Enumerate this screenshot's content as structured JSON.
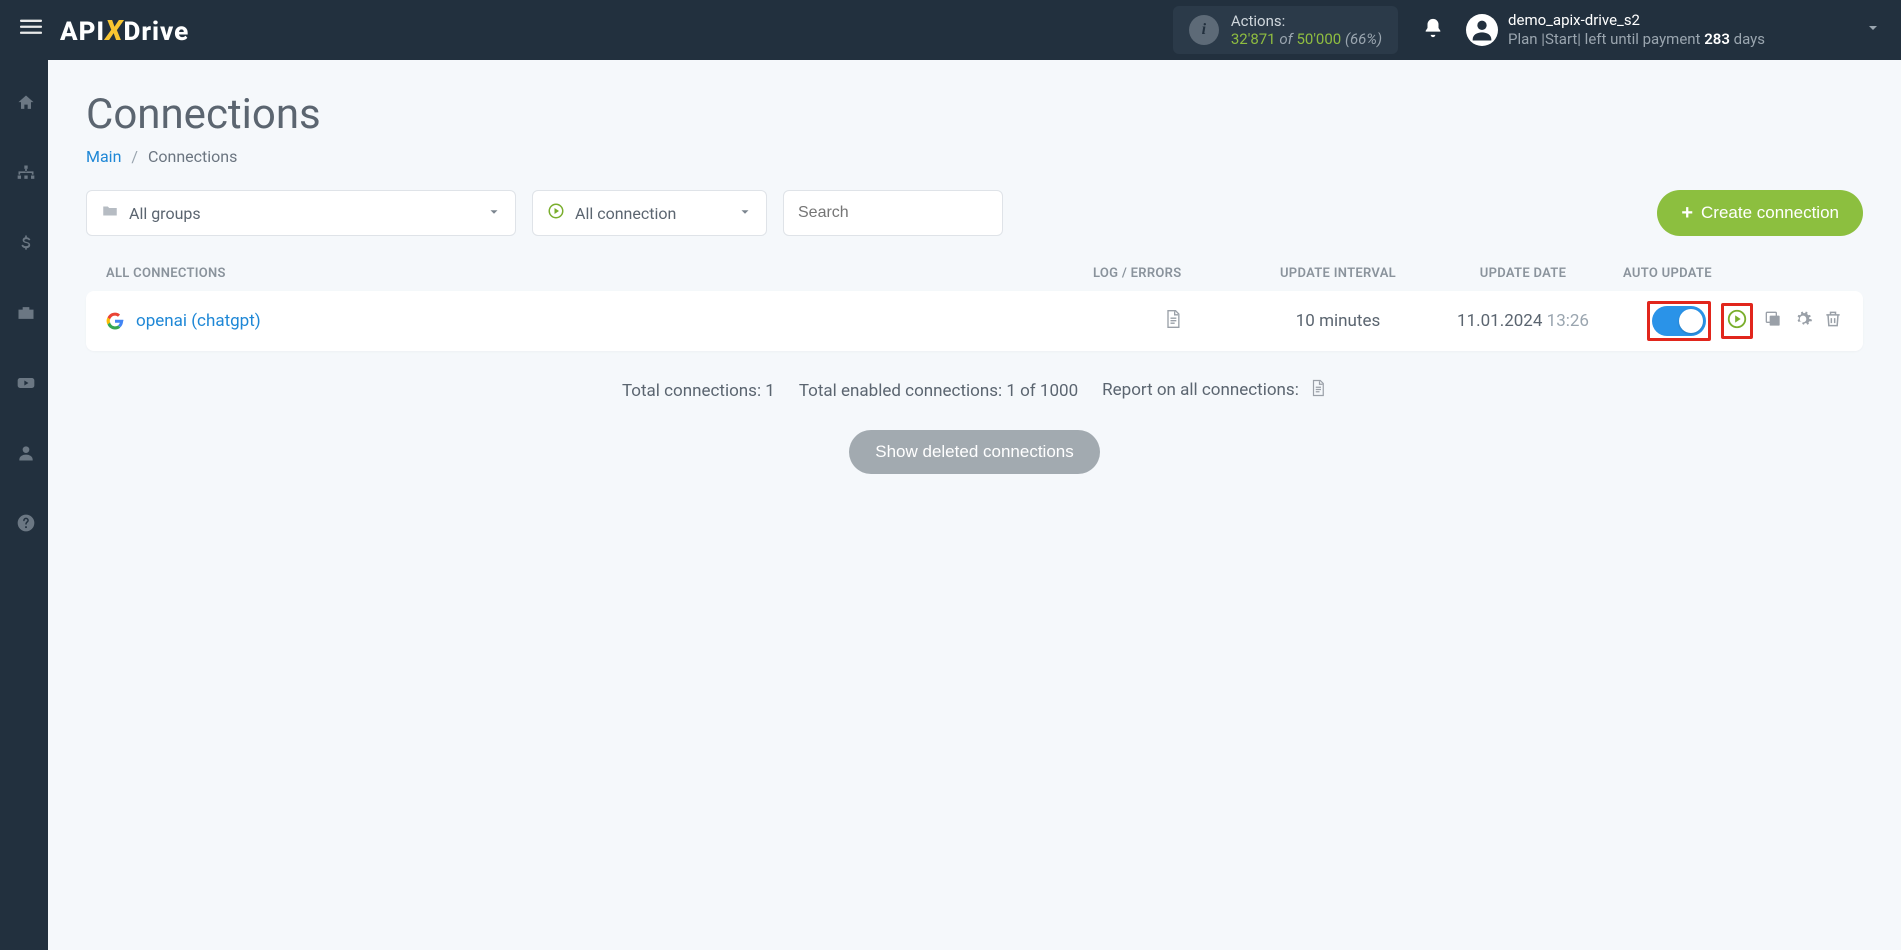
{
  "header": {
    "actions_label": "Actions:",
    "actions_count": "32'871",
    "actions_of": "of",
    "actions_limit": "50'000",
    "actions_pct": "(66%)",
    "username": "demo_apix-drive_s2",
    "plan_prefix": "Plan |Start| left until payment ",
    "plan_days_num": "283",
    "plan_days_suffix": " days"
  },
  "page": {
    "title": "Connections",
    "breadcrumb_main": "Main",
    "breadcrumb_current": "Connections",
    "groups_select": "All groups",
    "status_select": "All connection",
    "search_placeholder": "Search",
    "create_btn": "Create connection",
    "th_name": "ALL CONNECTIONS",
    "th_log": "LOG / ERRORS",
    "th_interval": "UPDATE INTERVAL",
    "th_date": "UPDATE DATE",
    "th_auto": "AUTO UPDATE",
    "row_name": "openai (chatgpt)",
    "row_interval": "10 minutes",
    "row_date": "11.01.2024",
    "row_time": "13:26",
    "stats_total": "Total connections: 1",
    "stats_enabled": "Total enabled connections: 1 of 1000",
    "stats_report": "Report on all connections:",
    "deleted_btn": "Show deleted connections"
  }
}
